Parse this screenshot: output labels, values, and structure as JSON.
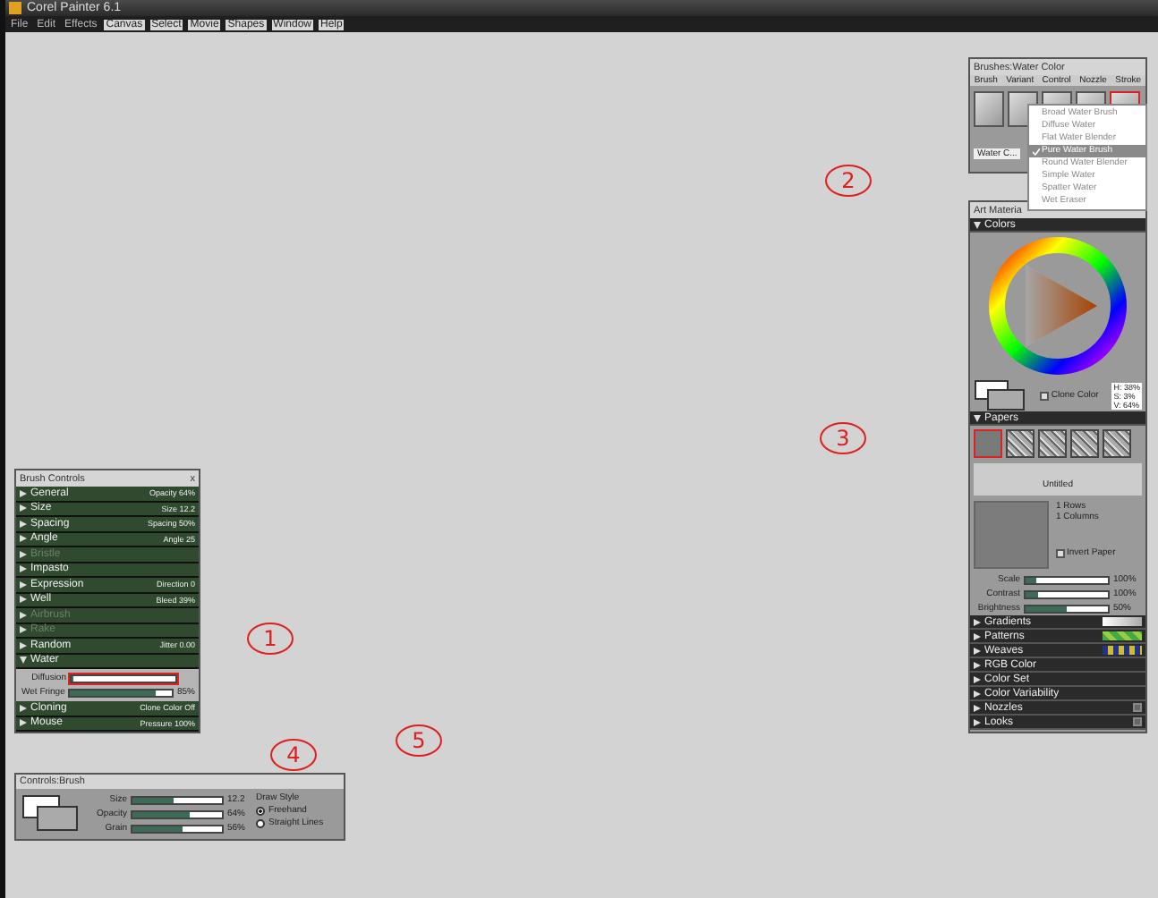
{
  "window": {
    "title": "Corel Painter 6.1"
  },
  "menu": [
    {
      "label": "File",
      "enabled": false
    },
    {
      "label": "Edit",
      "enabled": false
    },
    {
      "label": "Effects",
      "enabled": false
    },
    {
      "label": "Canvas",
      "enabled": true
    },
    {
      "label": "Select",
      "enabled": true
    },
    {
      "label": "Movie",
      "enabled": true
    },
    {
      "label": "Shapes",
      "enabled": true
    },
    {
      "label": "Window",
      "enabled": true
    },
    {
      "label": "Help",
      "enabled": true
    }
  ],
  "brush_controls": {
    "title": "Brush Controls",
    "close": "x",
    "sections": [
      {
        "label": "General",
        "value": "Opacity 64%",
        "kind": "collapsed"
      },
      {
        "label": "Size",
        "value": "Size 12.2",
        "kind": "collapsed"
      },
      {
        "label": "Spacing",
        "value": "Spacing 50%",
        "kind": "collapsed"
      },
      {
        "label": "Angle",
        "value": "Angle 25",
        "kind": "collapsed"
      },
      {
        "label": "Bristle",
        "kind": "disabled"
      },
      {
        "label": "Impasto",
        "kind": "collapsed"
      },
      {
        "label": "Expression",
        "value": "Direction 0",
        "kind": "collapsed"
      },
      {
        "label": "Well",
        "value": "Bleed 39%",
        "kind": "collapsed"
      },
      {
        "label": "Airbrush",
        "kind": "disabled"
      },
      {
        "label": "Rake",
        "kind": "disabled"
      },
      {
        "label": "Random",
        "value": "Jitter 0.00",
        "kind": "collapsed"
      },
      {
        "label": "Water",
        "kind": "expanded",
        "sliders": [
          {
            "label": "Diffusion",
            "level": 0.02,
            "highlighted": true
          },
          {
            "label": "Wet Fringe",
            "level": 0.85,
            "reading": "85%",
            "highlighted": false
          }
        ]
      },
      {
        "label": "Cloning",
        "value": "Clone Color Off",
        "kind": "collapsed"
      },
      {
        "label": "Mouse",
        "value": "Pressure 100%",
        "kind": "collapsed"
      }
    ]
  },
  "controls_brush": {
    "title": "Controls:Brush",
    "sliders": [
      {
        "label": "Size",
        "level": 0.45,
        "reading": "12.2"
      },
      {
        "label": "Opacity",
        "level": 0.64,
        "reading": "64%"
      },
      {
        "label": "Grain",
        "level": 0.56,
        "reading": "56%"
      }
    ],
    "draw_style": {
      "title": "Draw Style",
      "options": [
        {
          "label": "Freehand",
          "selected": true
        },
        {
          "label": "Straight Lines",
          "selected": false
        }
      ]
    }
  },
  "brushes": {
    "title": "Brushes:Water Color",
    "tabs": [
      "Brush",
      "Variant",
      "Control",
      "Nozzle",
      "Stroke"
    ],
    "category": "Water C...",
    "variants": [
      {
        "label": "Broad Water Brush",
        "selected": false
      },
      {
        "label": "Diffuse Water",
        "selected": false
      },
      {
        "label": "Flat Water Blender",
        "selected": false
      },
      {
        "label": "Pure Water Brush",
        "selected": true
      },
      {
        "label": "Round Water Blender",
        "selected": false
      },
      {
        "label": "Simple Water",
        "selected": false
      },
      {
        "label": "Spatter Water",
        "selected": false
      },
      {
        "label": "Wet Eraser",
        "selected": false
      }
    ]
  },
  "art_materials": {
    "title": "Art Materia",
    "colors": {
      "title": "Colors",
      "clone_color": {
        "label": "Clone Color",
        "checked": false
      },
      "readouts": [
        "H: 38%",
        "S: 3%",
        "V: 64%"
      ]
    },
    "papers": {
      "title": "Papers",
      "swatches": [
        {
          "selected": true
        },
        {
          "selected": false
        },
        {
          "selected": false
        },
        {
          "selected": false
        },
        {
          "selected": false
        }
      ],
      "name": "Untitled",
      "rows": "1 Rows",
      "columns": "1 Columns",
      "invert": {
        "label": "Invert Paper",
        "checked": false
      },
      "sliders": [
        {
          "label": "Scale",
          "level": 0.12,
          "reading": "100%"
        },
        {
          "label": "Contrast",
          "level": 0.15,
          "reading": "100%"
        },
        {
          "label": "Brightness",
          "level": 0.5,
          "reading": "50%"
        }
      ]
    },
    "sections": [
      {
        "label": "Gradients",
        "kind": "gradient"
      },
      {
        "label": "Patterns",
        "kind": "pattern"
      },
      {
        "label": "Weaves",
        "kind": "weave"
      },
      {
        "label": "RGB Color",
        "kind": "plain"
      },
      {
        "label": "Color Set",
        "kind": "plain"
      },
      {
        "label": "Color Variability",
        "kind": "plain"
      },
      {
        "label": "Nozzles",
        "kind": "button"
      },
      {
        "label": "Looks",
        "kind": "button"
      }
    ]
  },
  "annotations": [
    "1",
    "2",
    "3",
    "4",
    "5"
  ]
}
